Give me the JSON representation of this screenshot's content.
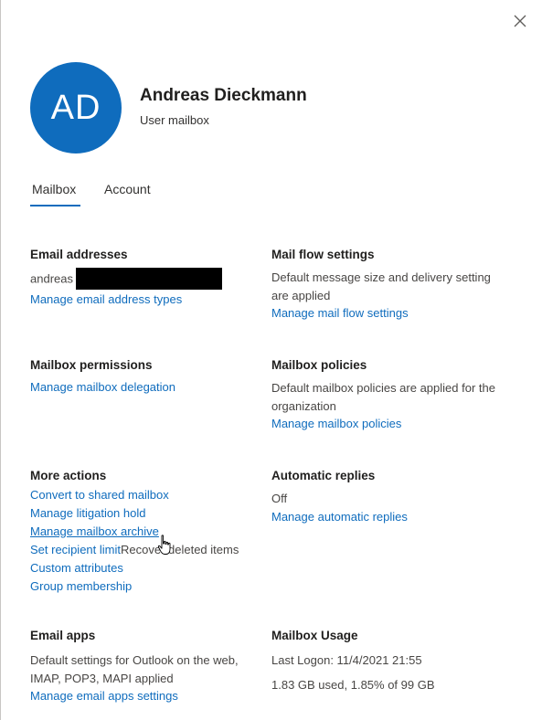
{
  "user": {
    "initials": "AD",
    "name": "Andreas Dieckmann",
    "type": "User mailbox"
  },
  "tabs": [
    {
      "label": "Mailbox",
      "active": true
    },
    {
      "label": "Account",
      "active": false
    }
  ],
  "email_addresses": {
    "title": "Email addresses",
    "value": "andreas",
    "link": "Manage email address types"
  },
  "mail_flow": {
    "title": "Mail flow settings",
    "text": "Default message size and delivery setting are applied",
    "link": "Manage mail flow settings"
  },
  "permissions": {
    "title": "Mailbox permissions",
    "link": "Manage mailbox delegation"
  },
  "policies": {
    "title": "Mailbox policies",
    "text": "Default mailbox policies are applied for the organization",
    "link": "Manage mailbox policies"
  },
  "more_actions": {
    "title": "More actions",
    "links": [
      "Convert to shared mailbox",
      "Manage litigation hold",
      "Manage mailbox archive",
      "Set recipient limit",
      "Custom attributes",
      "Group membership"
    ],
    "hover_tooltip": "Recover deleted items"
  },
  "auto_replies": {
    "title": "Automatic replies",
    "status": "Off",
    "link": "Manage automatic replies"
  },
  "email_apps": {
    "title": "Email apps",
    "text": "Default settings for Outlook on the web, IMAP, POP3, MAPI applied",
    "link": "Manage email apps settings"
  },
  "usage": {
    "title": "Mailbox Usage",
    "last_logon": "Last Logon: 11/4/2021 21:55",
    "used": "1.83 GB used, 1.85% of 99 GB"
  },
  "colors": {
    "accent": "#0f6cbd",
    "avatar_bg": "#0f6cbd"
  }
}
